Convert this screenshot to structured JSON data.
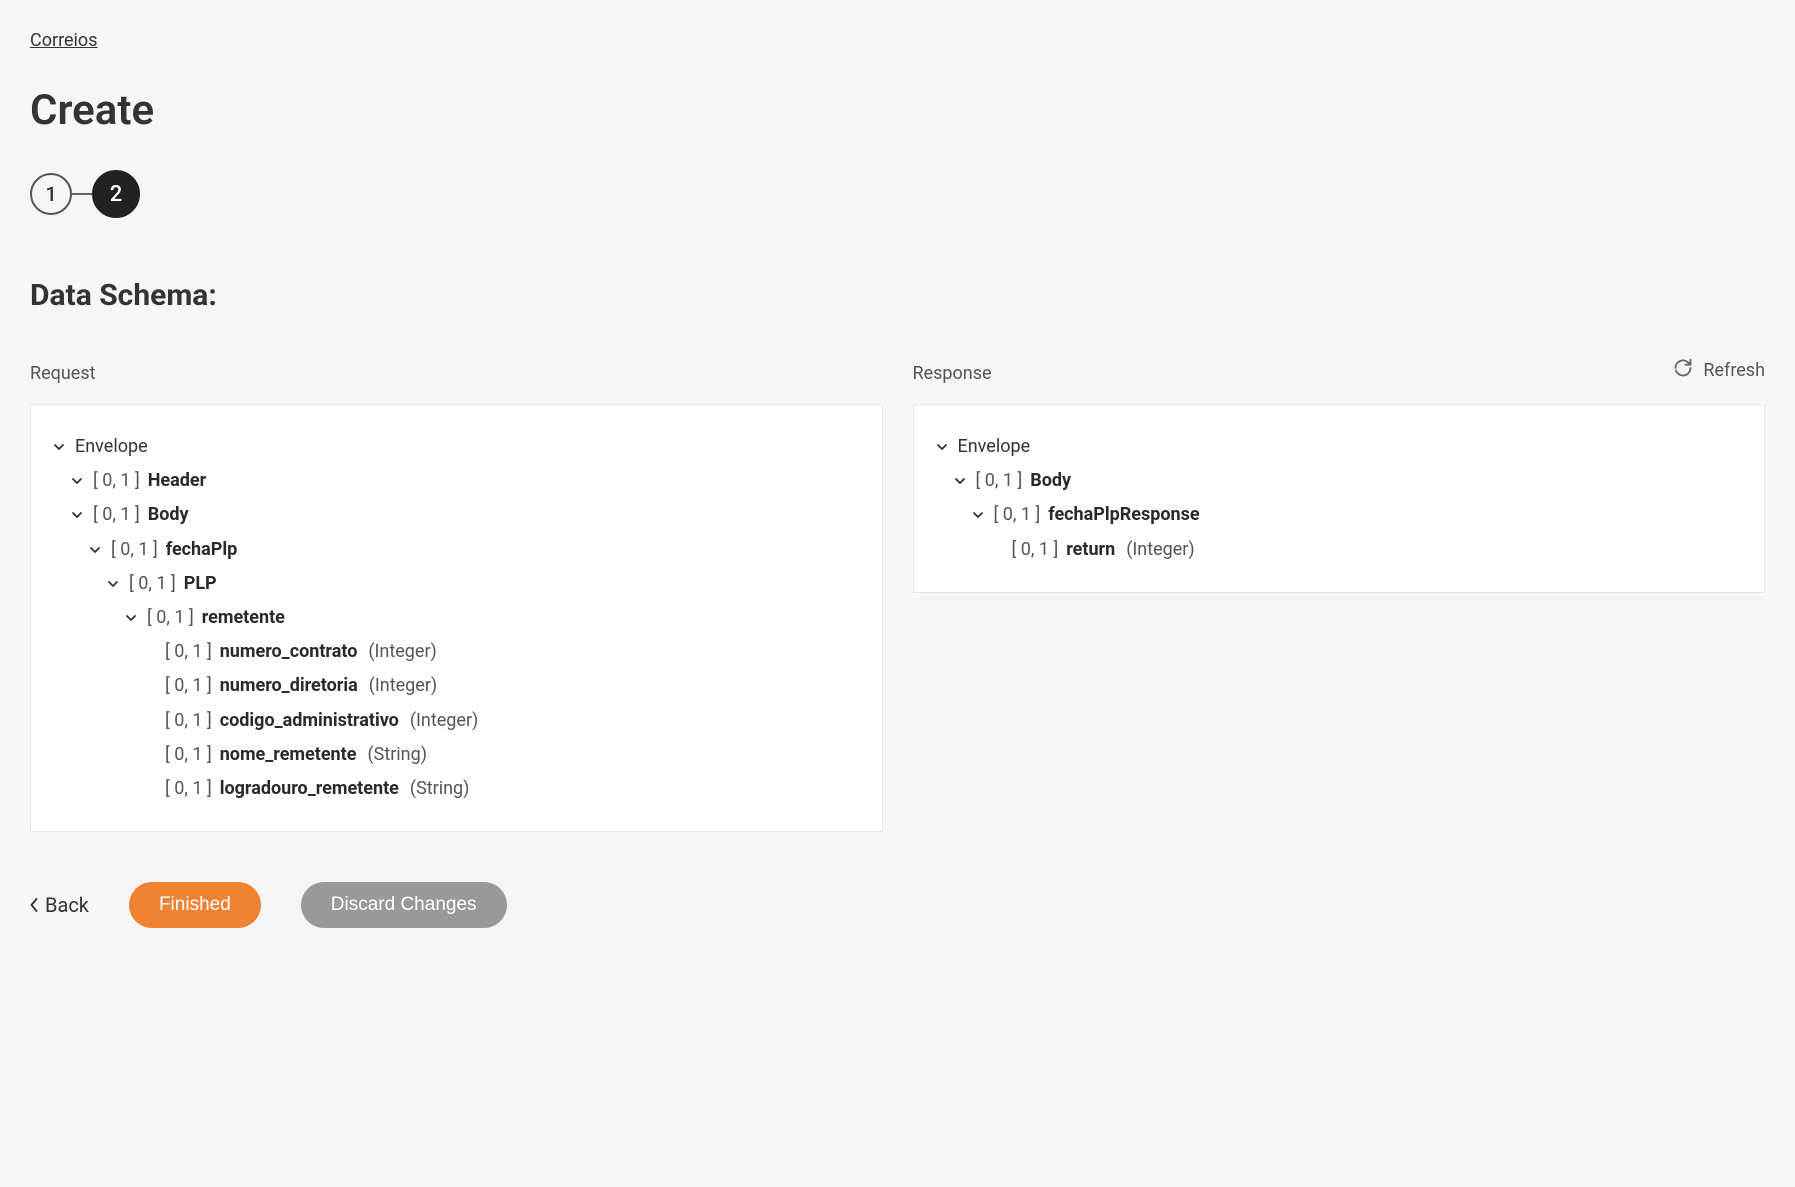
{
  "breadcrumb": "Correios",
  "page_title": "Create",
  "stepper": {
    "step1": "1",
    "step2": "2"
  },
  "section_heading": "Data Schema:",
  "refresh_label": "Refresh",
  "request_label": "Request",
  "response_label": "Response",
  "request_tree": [
    {
      "indent": 0,
      "chevron": true,
      "card": "",
      "name": "Envelope",
      "bold": false,
      "type": ""
    },
    {
      "indent": 1,
      "chevron": true,
      "card": "[ 0, 1 ]",
      "name": "Header",
      "bold": true,
      "type": ""
    },
    {
      "indent": 1,
      "chevron": true,
      "card": "[ 0, 1 ]",
      "name": "Body",
      "bold": true,
      "type": ""
    },
    {
      "indent": 2,
      "chevron": true,
      "card": "[ 0, 1 ]",
      "name": "fechaPlp",
      "bold": true,
      "type": ""
    },
    {
      "indent": 3,
      "chevron": true,
      "card": "[ 0, 1 ]",
      "name": "PLP",
      "bold": true,
      "type": ""
    },
    {
      "indent": 4,
      "chevron": true,
      "card": "[ 0, 1 ]",
      "name": "remetente",
      "bold": true,
      "type": ""
    },
    {
      "indent": 5,
      "chevron": false,
      "card": "[ 0, 1 ]",
      "name": "numero_contrato",
      "bold": true,
      "type": "(Integer)"
    },
    {
      "indent": 5,
      "chevron": false,
      "card": "[ 0, 1 ]",
      "name": "numero_diretoria",
      "bold": true,
      "type": "(Integer)"
    },
    {
      "indent": 5,
      "chevron": false,
      "card": "[ 0, 1 ]",
      "name": "codigo_administrativo",
      "bold": true,
      "type": "(Integer)"
    },
    {
      "indent": 5,
      "chevron": false,
      "card": "[ 0, 1 ]",
      "name": "nome_remetente",
      "bold": true,
      "type": "(String)"
    },
    {
      "indent": 5,
      "chevron": false,
      "card": "[ 0, 1 ]",
      "name": "logradouro_remetente",
      "bold": true,
      "type": "(String)"
    }
  ],
  "response_tree": [
    {
      "indent": 0,
      "chevron": true,
      "card": "",
      "name": "Envelope",
      "bold": false,
      "type": ""
    },
    {
      "indent": 1,
      "chevron": true,
      "card": "[ 0, 1 ]",
      "name": "Body",
      "bold": true,
      "type": ""
    },
    {
      "indent": 2,
      "chevron": true,
      "card": "[ 0, 1 ]",
      "name": "fechaPlpResponse",
      "bold": true,
      "type": ""
    },
    {
      "indent": 3,
      "chevron": false,
      "card": "[ 0, 1 ]",
      "name": "return",
      "bold": true,
      "type": "(Integer)"
    }
  ],
  "footer": {
    "back": "Back",
    "finished": "Finished",
    "discard": "Discard Changes"
  }
}
